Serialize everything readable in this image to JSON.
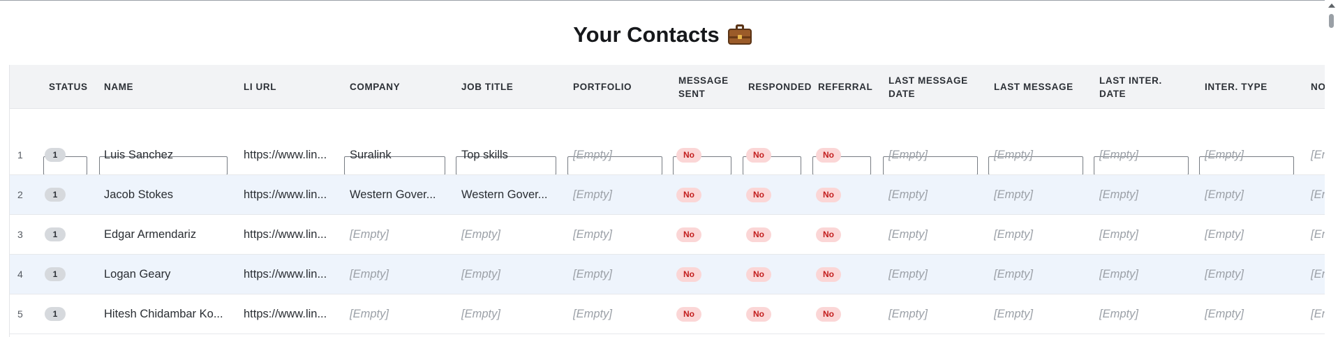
{
  "page": {
    "title": "Your Contacts",
    "title_emoji": "briefcase-icon"
  },
  "table": {
    "headers": [
      "STATUS",
      "NAME",
      "LI URL",
      "COMPANY",
      "JOB TITLE",
      "PORTFOLIO",
      "MESSAGE SENT",
      "RESPONDED",
      "REFERRAL",
      "LAST MESSAGE DATE",
      "LAST MESSAGE",
      "LAST INTER. DATE",
      "INTER. TYPE",
      "NOTES"
    ],
    "rows": [
      {
        "index": "1",
        "status": "1",
        "name": "Luis Sanchez",
        "li_url": "https://www.lin...",
        "company": "Suralink",
        "job_title": "Top skills",
        "portfolio": "[Empty]",
        "message_sent": "No",
        "responded": "No",
        "referral": "No",
        "last_message_date": "[Empty]",
        "last_message": "[Empty]",
        "last_inter_date": "[Empty]",
        "inter_type": "[Empty]",
        "notes": "[Em"
      },
      {
        "index": "2",
        "status": "1",
        "name": "Jacob Stokes",
        "li_url": "https://www.lin...",
        "company": "Western Gover...",
        "job_title": "Western Gover...",
        "portfolio": "[Empty]",
        "message_sent": "No",
        "responded": "No",
        "referral": "No",
        "last_message_date": "[Empty]",
        "last_message": "[Empty]",
        "last_inter_date": "[Empty]",
        "inter_type": "[Empty]",
        "notes": "[Em"
      },
      {
        "index": "3",
        "status": "1",
        "name": "Edgar Armendariz",
        "li_url": "https://www.lin...",
        "company": "[Empty]",
        "job_title": "[Empty]",
        "portfolio": "[Empty]",
        "message_sent": "No",
        "responded": "No",
        "referral": "No",
        "last_message_date": "[Empty]",
        "last_message": "[Empty]",
        "last_inter_date": "[Empty]",
        "inter_type": "[Empty]",
        "notes": "[Em"
      },
      {
        "index": "4",
        "status": "1",
        "name": "Logan Geary",
        "li_url": "https://www.lin...",
        "company": "[Empty]",
        "job_title": "[Empty]",
        "portfolio": "[Empty]",
        "message_sent": "No",
        "responded": "No",
        "referral": "No",
        "last_message_date": "[Empty]",
        "last_message": "[Empty]",
        "last_inter_date": "[Empty]",
        "inter_type": "[Empty]",
        "notes": "[Em"
      },
      {
        "index": "5",
        "status": "1",
        "name": "Hitesh Chidambar Ko...",
        "li_url": "https://www.lin...",
        "company": "[Empty]",
        "job_title": "[Empty]",
        "portfolio": "[Empty]",
        "message_sent": "No",
        "responded": "No",
        "referral": "No",
        "last_message_date": "[Empty]",
        "last_message": "[Empty]",
        "last_inter_date": "[Empty]",
        "inter_type": "[Empty]",
        "notes": "[Em"
      }
    ]
  },
  "colors": {
    "row_alt": "#eef4fc",
    "header_bg": "#f2f3f5",
    "no_badge_bg": "#fbd6d6",
    "no_badge_text": "#c21d1d",
    "empty_text": "#9ba0a7"
  }
}
